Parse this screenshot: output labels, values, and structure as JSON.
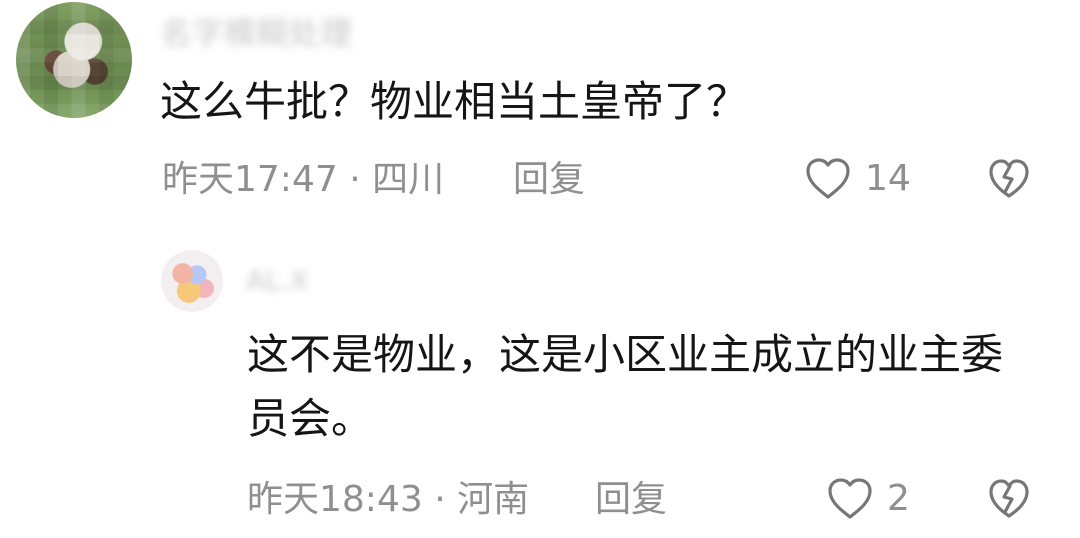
{
  "comments": [
    {
      "author": "名字模糊处理",
      "text": "这么牛批？物业相当土皇帝了？",
      "meta": "昨天17:47 · 四川",
      "reply_label": "回复",
      "likes": "14",
      "like_icon": "heart-outline-icon",
      "dislike_icon": "broken-heart-icon"
    },
    {
      "author": "AL.X",
      "text": "这不是物业，这是小区业主成立的业主委员会。",
      "meta": "昨天18:43 · 河南",
      "reply_label": "回复",
      "likes": "2",
      "like_icon": "heart-outline-icon",
      "dislike_icon": "broken-heart-icon"
    }
  ],
  "colors": {
    "background": "#ffffff",
    "primary_text": "#151515",
    "secondary_text": "#8f8f8f",
    "icon": "#777777"
  }
}
